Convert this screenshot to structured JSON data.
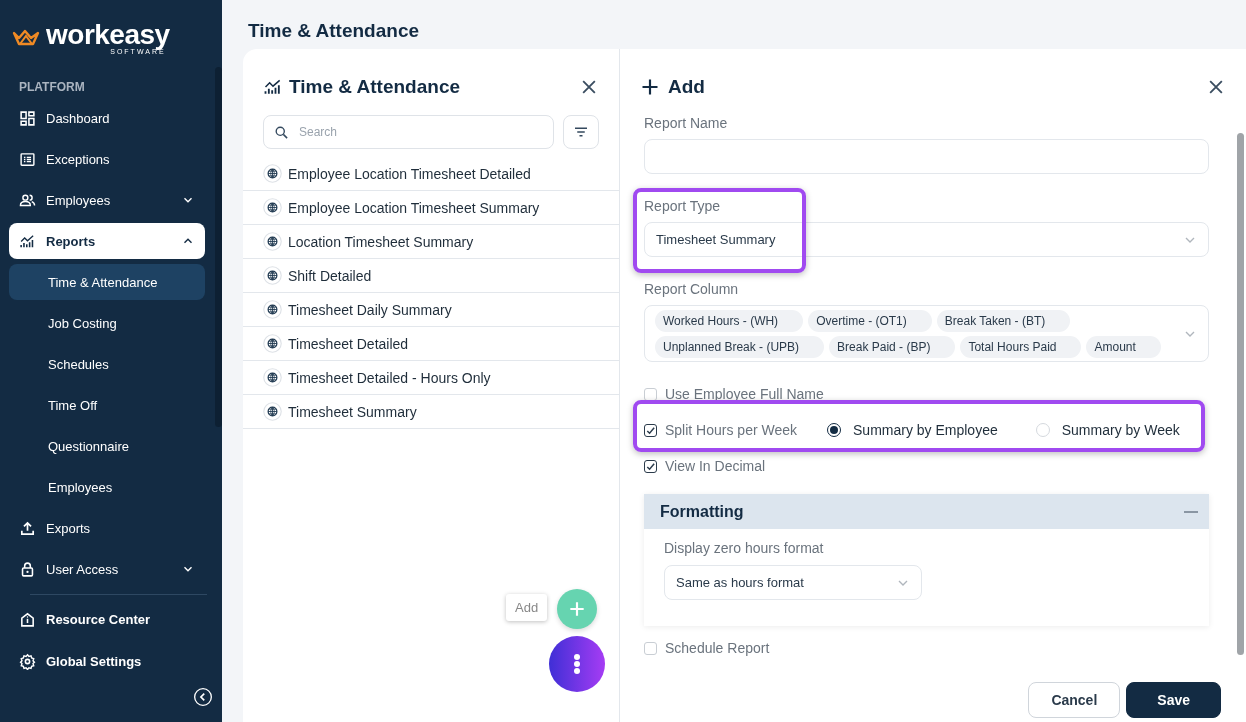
{
  "logo": {
    "name": "workeasy",
    "tagline": "SOFTWARE"
  },
  "sidebar": {
    "section": "PLATFORM",
    "items": [
      {
        "label": "Dashboard",
        "kind": "link",
        "selected": false
      },
      {
        "label": "Exceptions",
        "kind": "link",
        "selected": false
      },
      {
        "label": "Employees",
        "kind": "group",
        "expanded": false,
        "selected": false
      },
      {
        "label": "Reports",
        "kind": "group",
        "expanded": true,
        "selected": true,
        "children": [
          {
            "label": "Time & Attendance",
            "selected": true
          },
          {
            "label": "Job Costing",
            "selected": false
          },
          {
            "label": "Schedules",
            "selected": false
          },
          {
            "label": "Time Off",
            "selected": false
          },
          {
            "label": "Questionnaire",
            "selected": false
          },
          {
            "label": "Employees",
            "selected": false
          }
        ]
      },
      {
        "label": "Exports",
        "kind": "link",
        "selected": false
      },
      {
        "label": "User Access",
        "kind": "group",
        "expanded": false,
        "selected": false
      }
    ],
    "footer_items": [
      {
        "label": "Resource Center"
      },
      {
        "label": "Global Settings"
      }
    ]
  },
  "page_title": "Time & Attendance",
  "report_list": {
    "title": "Time & Attendance",
    "search": {
      "placeholder": "Search"
    },
    "items": [
      "Employee Location Timesheet Detailed",
      "Employee Location Timesheet Summary",
      "Location Timesheet Summary",
      "Shift Detailed",
      "Timesheet Daily Summary",
      "Timesheet Detailed",
      "Timesheet Detailed - Hours Only",
      "Timesheet Summary"
    ]
  },
  "fab": {
    "tooltip": "Add"
  },
  "form": {
    "title": "Add",
    "report_name": {
      "label": "Report Name"
    },
    "report_type": {
      "label": "Report Type",
      "value": "Timesheet Summary"
    },
    "report_column": {
      "label": "Report Column",
      "chips": [
        "Worked Hours - (WH)",
        "Overtime - (OT1)",
        "Break Taken - (BT)",
        "Unplanned Break - (UPB)",
        "Break Paid - (BP)",
        "Total Hours Paid",
        "Amount"
      ]
    },
    "options": [
      {
        "label": "Use Employee Full Name",
        "checked": false
      },
      {
        "label": "Split Hours per Week",
        "checked": true,
        "radios": [
          {
            "label": "Summary by Employee",
            "selected": true
          },
          {
            "label": "Summary by Week",
            "selected": false
          }
        ]
      },
      {
        "label": "View In Decimal",
        "checked": true
      }
    ],
    "formatting": {
      "title": "Formatting",
      "expanded": true,
      "field_label": "Display zero hours format",
      "value": "Same as hours format"
    },
    "schedule_report": {
      "label": "Schedule Report",
      "checked": false
    },
    "buttons": [
      {
        "label": "Cancel",
        "kind": "secondary"
      },
      {
        "label": "Save",
        "kind": "primary"
      }
    ]
  }
}
